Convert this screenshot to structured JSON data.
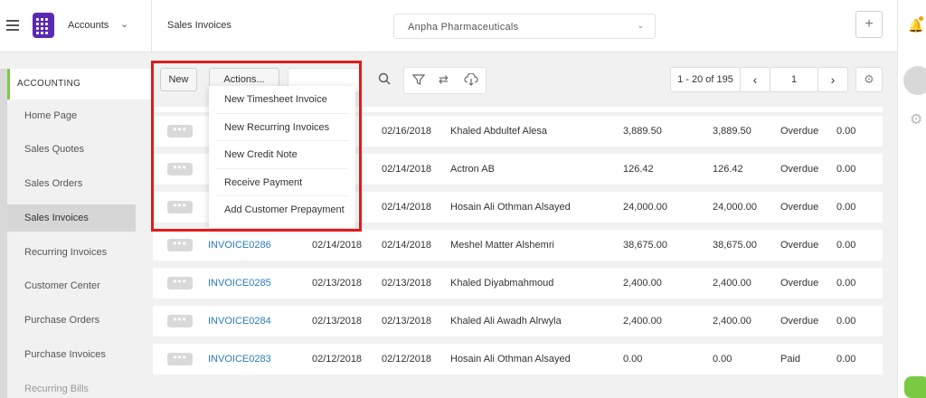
{
  "app": {
    "name": "Accounts",
    "page_title": "Sales Invoices",
    "company": "Anpha Pharmaceuticals"
  },
  "header": {
    "plus_label": "+"
  },
  "sidebar": {
    "section": "ACCOUNTING",
    "items": [
      {
        "label": "Home Page",
        "active": false
      },
      {
        "label": "Sales Quotes",
        "active": false
      },
      {
        "label": "Sales Orders",
        "active": false
      },
      {
        "label": "Sales Invoices",
        "active": true
      },
      {
        "label": "Recurring Invoices",
        "active": false
      },
      {
        "label": "Customer Center",
        "active": false
      },
      {
        "label": "Purchase Orders",
        "active": false
      },
      {
        "label": "Purchase Invoices",
        "active": false
      },
      {
        "label": "Recurring Bills",
        "active": false
      }
    ]
  },
  "toolbar": {
    "new_label": "New",
    "actions_label": "Actions...",
    "pager_range": "1 - 20 of 195",
    "page_number": "1",
    "prev_label": "‹",
    "next_label": "›"
  },
  "actions_menu": [
    "New Timesheet Invoice",
    "New Recurring Invoices",
    "New Credit Note",
    "Receive Payment",
    "Add Customer Prepayment"
  ],
  "rows": [
    {
      "invoice": "",
      "date": "",
      "due": "02/16/2018",
      "customer": "Khaled Abdultef Alesa",
      "amount": "3,889.50",
      "balance": "3,889.50",
      "status": "Overdue",
      "paid": "0.00"
    },
    {
      "invoice": "",
      "date": "",
      "due": "02/14/2018",
      "customer": "Actron AB",
      "amount": "126.42",
      "balance": "126.42",
      "status": "Overdue",
      "paid": "0.00"
    },
    {
      "invoice": "",
      "date": "",
      "due": "02/14/2018",
      "customer": "Hosain Ali Othman Alsayed",
      "amount": "24,000.00",
      "balance": "24,000.00",
      "status": "Overdue",
      "paid": "0.00"
    },
    {
      "invoice": "INVOICE0286",
      "date": "02/14/2018",
      "due": "02/14/2018",
      "customer": "Meshel Matter Alshemri",
      "amount": "38,675.00",
      "balance": "38,675.00",
      "status": "Overdue",
      "paid": "0.00"
    },
    {
      "invoice": "INVOICE0285",
      "date": "02/13/2018",
      "due": "02/13/2018",
      "customer": "Khaled Diyabmahmoud",
      "amount": "2,400.00",
      "balance": "2,400.00",
      "status": "Overdue",
      "paid": "0.00"
    },
    {
      "invoice": "INVOICE0284",
      "date": "02/13/2018",
      "due": "02/13/2018",
      "customer": "Khaled Ali Awadh Alrwyla",
      "amount": "2,400.00",
      "balance": "2,400.00",
      "status": "Overdue",
      "paid": "0.00"
    },
    {
      "invoice": "INVOICE0283",
      "date": "02/12/2018",
      "due": "02/12/2018",
      "customer": "Hosain Ali Othman Alsayed",
      "amount": "0.00",
      "balance": "0.00",
      "status": "Paid",
      "paid": "0.00"
    }
  ],
  "colors": {
    "accent_green": "#7ac943",
    "logo_purple": "#5b2ab3",
    "link_blue": "#2a7bbf",
    "highlight_red": "#e11b1b"
  }
}
